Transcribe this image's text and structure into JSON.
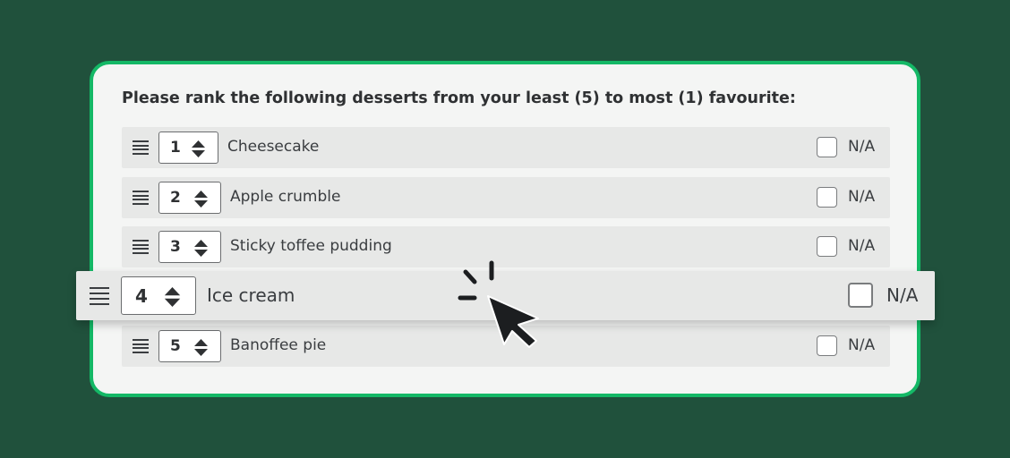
{
  "question": "Please rank the following desserts from your least (5) to most (1) favourite:",
  "na_label": "N/A",
  "rows": [
    {
      "rank": "1",
      "label": "Cheesecake"
    },
    {
      "rank": "2",
      "label": "Apple crumble"
    },
    {
      "rank": "3",
      "label": "Sticky toffee pudding"
    },
    {
      "rank": "5",
      "label": "Banoffee pie"
    }
  ],
  "dragged_row": {
    "rank": "4",
    "label": "Ice cream"
  },
  "icons": {
    "drag_handle": "drag-handle-icon",
    "stepper": "up-down-arrows-icon",
    "cursor": "mouse-pointer-click-icon"
  },
  "colors": {
    "background": "#20513c",
    "card_border": "#14b866",
    "row_background": "#e7e8e7"
  }
}
